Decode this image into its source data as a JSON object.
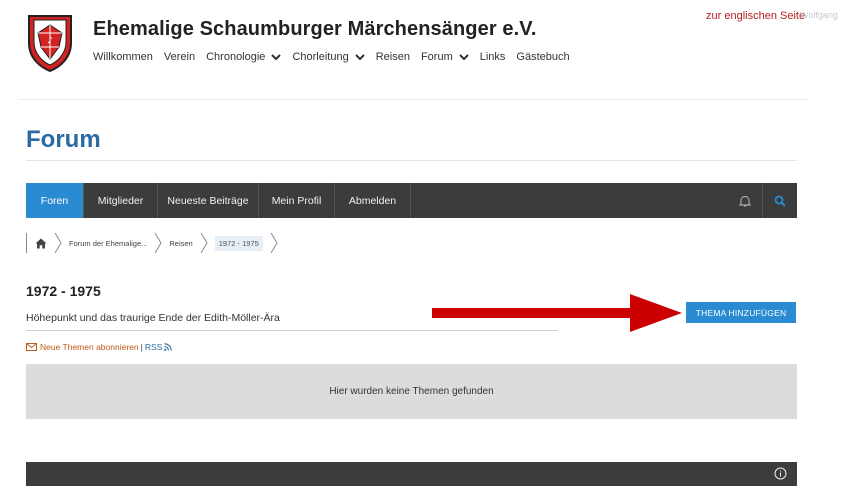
{
  "site": {
    "title": "Ehemalige Schaumburger Märchensänger e.V.",
    "english_link": "zur englischen Seite",
    "ghost_text": "Wolfgang"
  },
  "top_nav": [
    {
      "label": "Willkommen",
      "dropdown": false
    },
    {
      "label": "Verein",
      "dropdown": false
    },
    {
      "label": "Chronologie",
      "dropdown": true
    },
    {
      "label": "Chorleitung",
      "dropdown": true
    },
    {
      "label": "Reisen",
      "dropdown": false
    },
    {
      "label": "Forum",
      "dropdown": true
    },
    {
      "label": "Links",
      "dropdown": false
    },
    {
      "label": "Gästebuch",
      "dropdown": false
    }
  ],
  "page": {
    "title": "Forum"
  },
  "forum_nav": {
    "items": [
      {
        "label": "Foren",
        "active": true
      },
      {
        "label": "Mitglieder",
        "active": false
      },
      {
        "label": "Neueste Beiträge",
        "active": false
      },
      {
        "label": "Mein Profil",
        "active": false
      },
      {
        "label": "Abmelden",
        "active": false
      }
    ]
  },
  "breadcrumb": {
    "items": [
      "Forum der Ehemalige...",
      "Reisen",
      "1972 - 1975"
    ]
  },
  "subforum": {
    "title": "1972 - 1975",
    "description": "Höhepunkt und das traurige Ende der Edith-Möller-Ära",
    "add_button": "THEMA HINZUFÜGEN",
    "subscribe_label": "Neue Themen abonnieren",
    "separator": "|",
    "rss_label": "RSS",
    "empty_message": "Hier wurden keine Themen gefunden"
  },
  "colors": {
    "brand_blue": "#2a8bd3",
    "title_blue": "#2b6aa3",
    "nav_dark": "#3c3c3c",
    "annotation_red": "#cc0000",
    "link_orange": "#c05b18"
  }
}
